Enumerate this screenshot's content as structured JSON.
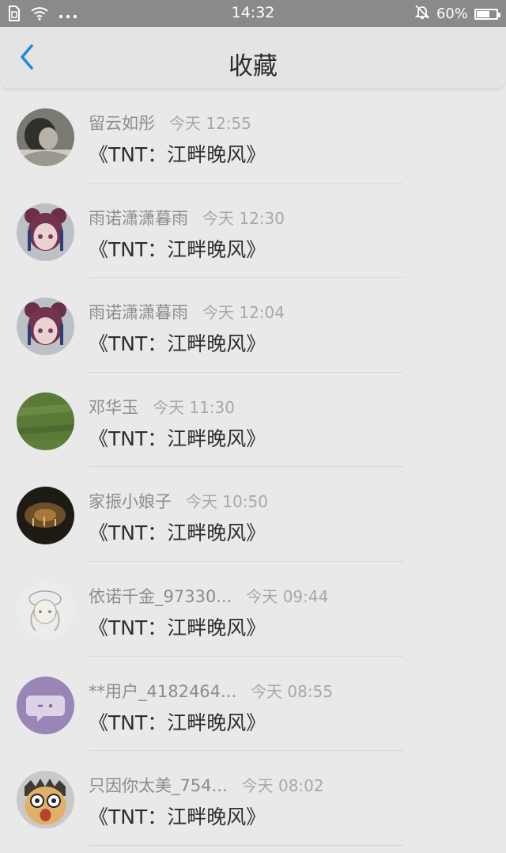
{
  "status_bar": {
    "time": "14:32",
    "battery": "60%",
    "battery_level": 0.6,
    "icons": [
      "sim-icon",
      "wifi-icon",
      "more-dots-icon",
      "silent-bell-icon",
      "battery-icon"
    ]
  },
  "header": {
    "title": "收藏",
    "back_icon": "chevron-left-icon",
    "accent": "#1a8bd6"
  },
  "items": [
    {
      "name": "留云如彤",
      "time": "今天 12:55",
      "title": "《TNT：江畔晚风》",
      "avatar": "photo-girl"
    },
    {
      "name": "雨诺潇潇暮雨",
      "time": "今天 12:30",
      "title": "《TNT：江畔晚风》",
      "avatar": "anime-girl"
    },
    {
      "name": "雨诺潇潇暮雨",
      "time": "今天 12:04",
      "title": "《TNT：江畔晚风》",
      "avatar": "anime-girl"
    },
    {
      "name": "邓华玉",
      "time": "今天 11:30",
      "title": "《TNT：江畔晚风》",
      "avatar": "grass"
    },
    {
      "name": "家振小娘子",
      "time": "今天 10:50",
      "title": "《TNT：江畔晚风》",
      "avatar": "night-scene"
    },
    {
      "name": "依诺千金_97330...",
      "time": "今天 09:44",
      "title": "《TNT：江畔晚风》",
      "avatar": "sketch-girl"
    },
    {
      "name": "**用户_4182464...",
      "time": "今天 08:55",
      "title": "《TNT：江畔晚风》",
      "avatar": "purple-chat"
    },
    {
      "name": "只因你太美_754...",
      "time": "今天 08:02",
      "title": "《TNT：江畔晚风》",
      "avatar": "cartoon-face"
    }
  ]
}
